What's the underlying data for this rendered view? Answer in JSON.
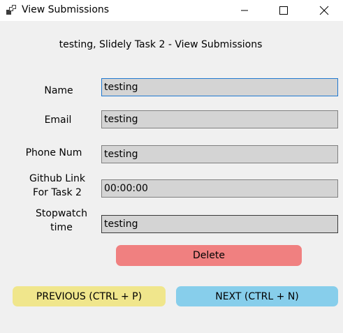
{
  "window": {
    "title": "View Submissions",
    "icon": "app-icon"
  },
  "heading": "testing, Slidely Task 2 - View Submissions",
  "fields": {
    "name": {
      "label": "Name",
      "value": "testing"
    },
    "email": {
      "label": "Email",
      "value": "testing"
    },
    "phone": {
      "label": "Phone Num",
      "value": "testing"
    },
    "github": {
      "label_line1": "Github Link",
      "label_line2": "For Task 2",
      "value": "00:00:00"
    },
    "stopwatch": {
      "label_line1": "Stopwatch",
      "label_line2": "time",
      "value": "testing"
    }
  },
  "buttons": {
    "delete": "Delete",
    "previous": "PREVIOUS (CTRL + P)",
    "next": "NEXT (CTRL + N)"
  },
  "colors": {
    "delete": "#f08080",
    "previous": "#f0e68c",
    "next": "#87ceeb"
  }
}
